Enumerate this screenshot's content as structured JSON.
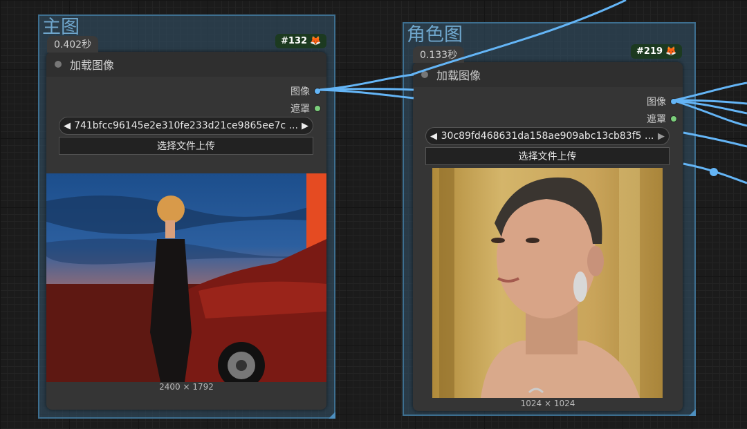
{
  "group_main": {
    "title": "主图"
  },
  "group_role": {
    "title": "角色图"
  },
  "node_main": {
    "time": "0.402秒",
    "id": "#132",
    "title": "加载图像",
    "output_image": "图像",
    "output_mask": "遮罩",
    "filename": "741bfcc96145e2e310fe233d21ce9865ee7c ...",
    "upload_label": "选择文件上传",
    "dims": "2400 × 1792"
  },
  "node_role": {
    "time": "0.133秒",
    "id": "#219",
    "title": "加载图像",
    "output_image": "图像",
    "output_mask": "遮罩",
    "filename": "30c89fd468631da158ae909abc13cb83f5 ...",
    "upload_label": "选择文件上传",
    "dims": "1024 × 1024"
  },
  "colors": {
    "wire_image": "#64b5f6",
    "port_mask": "#7ccf7c",
    "group_border": "#3d6f90",
    "badge_bg": "#1c3a20"
  },
  "icons": {
    "fox": "fox-icon",
    "left": "arrow-left-icon",
    "right": "arrow-right-icon"
  }
}
